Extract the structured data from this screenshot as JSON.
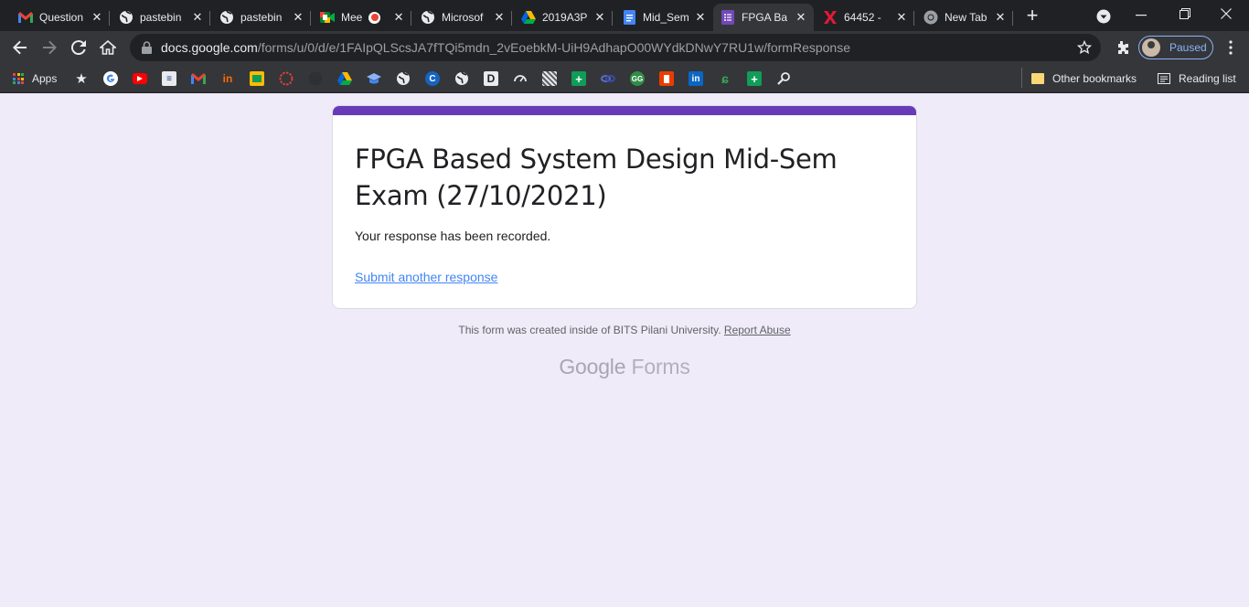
{
  "browser": {
    "tabs": [
      {
        "title": "Question",
        "icon": "gmail-icon"
      },
      {
        "title": "pastebin",
        "icon": "globe-icon"
      },
      {
        "title": "pastebin",
        "icon": "globe-icon"
      },
      {
        "title": "Mee",
        "icon": "meet-icon"
      },
      {
        "title": "Microsof",
        "icon": "globe-icon"
      },
      {
        "title": "2019A3P",
        "icon": "drive-icon"
      },
      {
        "title": "Mid_Sem",
        "icon": "docs-icon"
      },
      {
        "title": "FPGA Ba",
        "icon": "forms-icon",
        "active": true
      },
      {
        "title": "64452 -",
        "icon": "xilinx-icon"
      },
      {
        "title": "New Tab",
        "icon": "chrome-icon"
      }
    ],
    "url_host": "docs.google.com",
    "url_path": "/forms/u/0/d/e/1FAIpQLScsJA7fTQi5mdn_2vEoebkM-UiH9AdhapO00WYdkDNwY7RU1w/formResponse",
    "profile_label": "Paused",
    "bookmarks": {
      "apps_label": "Apps",
      "other_label": "Other bookmarks",
      "reading_label": "Reading list"
    }
  },
  "form": {
    "title": "FPGA Based System Design Mid-Sem Exam (27/10/2021)",
    "message": "Your response has been recorded.",
    "submit_another": "Submit another response",
    "accent_color": "#673ab7"
  },
  "footer": {
    "created_text": "This form was created inside of BITS Pilani University.",
    "report_abuse": "Report Abuse",
    "logo_google": "Google",
    "logo_forms": "Forms"
  }
}
